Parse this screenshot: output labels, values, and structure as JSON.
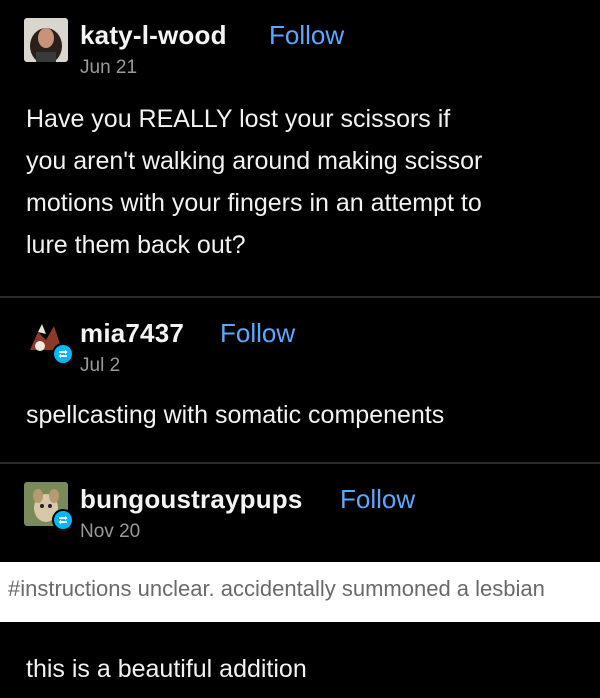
{
  "posts": [
    {
      "username": "katy-l-wood",
      "follow_label": "Follow",
      "date": "Jun 21",
      "avatar_icon": "profile-photo-icon",
      "body_lines": [
        "Have you REALLY lost your scissors if",
        "you aren't walking around making scissor",
        "motions with your fingers in an attempt to",
        "lure them back out?"
      ]
    },
    {
      "username": "mia7437",
      "follow_label": "Follow",
      "date": "Jul 2",
      "avatar_icon": "animal-avatar-icon",
      "reblog_icon": "reblog-icon",
      "body_lines": [
        "spellcasting with somatic compenents"
      ]
    },
    {
      "username": "bungoustraypups",
      "follow_label": "Follow",
      "date": "Nov 20",
      "avatar_icon": "dog-avatar-icon",
      "reblog_icon": "reblog-icon",
      "tags": "#instructions unclear. accidentally summoned a lesbian",
      "body_lines": [
        "this is a beautiful addition"
      ]
    }
  ],
  "colors": {
    "background": "#000000",
    "link": "#5aa8ff",
    "reblog_badge": "#00b8ff",
    "tag_bar": "#ffffff"
  }
}
